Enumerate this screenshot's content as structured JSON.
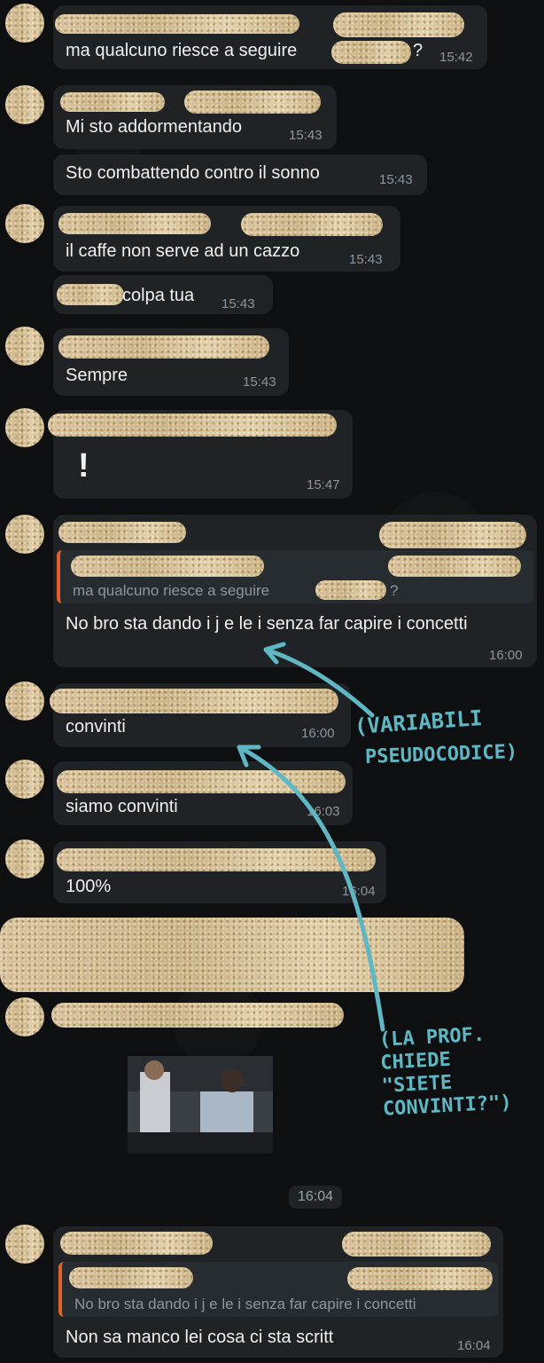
{
  "messages": {
    "m1": {
      "text": "ma qualcuno riesce a seguire",
      "suffix": "?",
      "time": "15:42"
    },
    "m2": {
      "text": "Mi sto addormentando",
      "time": "15:43"
    },
    "m3": {
      "text": "Sto combattendo contro il sonno",
      "time": "15:43"
    },
    "m4": {
      "text": "il caffe non serve ad un cazzo",
      "time": "15:43"
    },
    "m5": {
      "text": "colpa tua",
      "time": "15:43"
    },
    "m6": {
      "text": "Sempre",
      "time": "15:43"
    },
    "m7": {
      "text": "!",
      "time": "15:47"
    },
    "m8": {
      "quote": "ma qualcuno riesce a seguire",
      "quote_suffix": "?",
      "text": "No bro sta dando i j e le i senza far capire i concetti",
      "time": "16:00"
    },
    "m9": {
      "text": "convinti",
      "time": "16:00"
    },
    "m10": {
      "text": "siamo convinti",
      "time": "16:03"
    },
    "m11": {
      "text": "100%",
      "time": "16:04"
    },
    "m12": {
      "time": "16:04"
    },
    "m13": {
      "quote": "No bro sta dando i j e le i senza far capire i concetti",
      "text": "Non sa manco lei cosa ci sta scritt",
      "time": "16:04"
    }
  },
  "annotations": {
    "variabili_line1": "(VARIABILI",
    "variabili_line2": "PSEUDOCODICE)",
    "prof_line1": "(LA PROF.",
    "prof_line2": "CHIEDE",
    "prof_line3": "\"SIETE",
    "prof_line4": "CONVINTI?\")"
  },
  "colors": {
    "bubble": "#1f2326",
    "quote_bar": "#e2602a",
    "annotation": "#5fb7c3"
  }
}
